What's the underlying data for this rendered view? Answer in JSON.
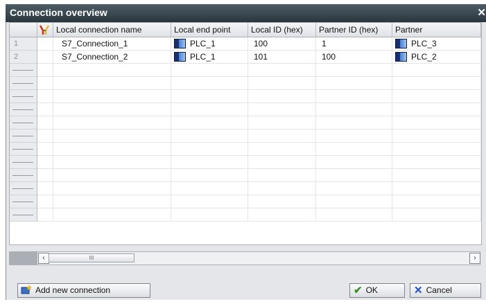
{
  "window": {
    "title": "Connection overview",
    "close_glyph": "✕"
  },
  "table": {
    "headers": [
      "Local connection name",
      "Local end point",
      "Local ID (hex)",
      "Partner ID (hex)",
      "Partner"
    ],
    "rows": [
      {
        "num": "1",
        "name": "S7_Connection_1",
        "local_end_point": "PLC_1",
        "local_id": "100",
        "partner_id": "1",
        "partner": "PLC_3"
      },
      {
        "num": "2",
        "name": "S7_Connection_2",
        "local_end_point": "PLC_1",
        "local_id": "101",
        "partner_id": "100",
        "partner": "PLC_2"
      }
    ],
    "empty_row_count": 12,
    "header_icon": "connection-filter-icon",
    "device_icon": "plc-device-icon"
  },
  "scrollbar": {
    "left": "‹",
    "thumb": "III",
    "right": "›"
  },
  "buttons": {
    "add": "Add new connection",
    "ok": "OK",
    "cancel": "Cancel"
  },
  "colors": {
    "titlebar": "#3a474f",
    "ok_check": "#3b8f2e",
    "cancel_x": "#1f4fc9",
    "add_icon": "#e8b82e"
  }
}
